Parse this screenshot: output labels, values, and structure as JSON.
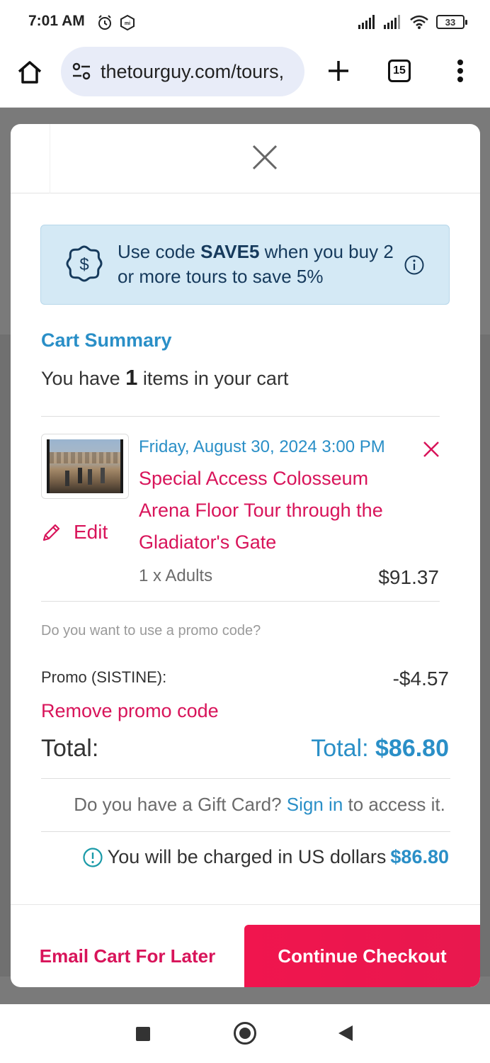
{
  "status_bar": {
    "time": "7:01 AM",
    "battery": "33",
    "icons": [
      "alarm-icon",
      "mi-icon",
      "signal-icon",
      "signal-icon",
      "wifi-icon",
      "battery-icon"
    ]
  },
  "browser": {
    "url": "thetourguy.com/tours,",
    "tab_count": "15",
    "icons": [
      "home-icon",
      "site-settings-icon",
      "new-tab-plus-icon",
      "tabs-icon",
      "more-vert-icon"
    ]
  },
  "modal": {
    "promo_banner": {
      "text_before": "Use code ",
      "code": "SAVE5",
      "text_after": " when you buy 2 or more tours to save 5%"
    },
    "cart_summary_title": "Cart Summary",
    "items_prefix": "You have ",
    "items_count": "1",
    "items_suffix": " items in your cart",
    "item": {
      "date": "Friday, August 30, 2024 3:00 PM",
      "title": "Special Access Colosseum Arena Floor Tour through the Gladiator's Gate",
      "quantity": "1 x Adults",
      "price": "$91.37",
      "edit_label": "Edit"
    },
    "promo_question": "Do you want to use a promo code?",
    "promo_label": "Promo (SISTINE):",
    "promo_amount": "-$4.57",
    "remove_promo": "Remove promo code",
    "total_label": "Total:",
    "total_prefix": "Total: ",
    "total_amount": "$86.80",
    "giftcard_before": "Do you have a Gift Card? ",
    "giftcard_link": "Sign in",
    "giftcard_after": " to access it.",
    "charge_text": "You will be charged in US dollars ",
    "charge_amount": "$86.80",
    "email_cart_label": "Email Cart For Later",
    "checkout_label": "Continue Checkout"
  },
  "colors": {
    "accent_blue": "#2a8fc7",
    "accent_pink": "#d8145a",
    "checkout_red": "#f0154e",
    "banner_bg": "#d4e9f5"
  }
}
